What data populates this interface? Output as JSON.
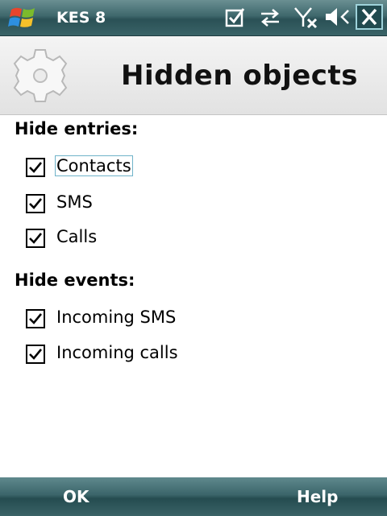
{
  "statusbar": {
    "app_title": "KES 8",
    "icons": [
      "windows-logo",
      "task-check-icon",
      "connectivity-icon",
      "no-signal-icon",
      "speaker-icon",
      "close-icon"
    ]
  },
  "header": {
    "title": "Hidden objects",
    "icon": "gear-icon"
  },
  "sections": [
    {
      "title": "Hide entries:",
      "items": [
        {
          "label": "Contacts",
          "checked": true,
          "focused": true
        },
        {
          "label": "SMS",
          "checked": true
        },
        {
          "label": "Calls",
          "checked": true
        }
      ]
    },
    {
      "title": "Hide events:",
      "items": [
        {
          "label": "Incoming SMS",
          "checked": true
        },
        {
          "label": "Incoming calls",
          "checked": true
        }
      ]
    }
  ],
  "softkeys": {
    "left": "OK",
    "right": "Help"
  },
  "colors": {
    "bar": "#3e676c",
    "focus": "#6fb3c9"
  }
}
